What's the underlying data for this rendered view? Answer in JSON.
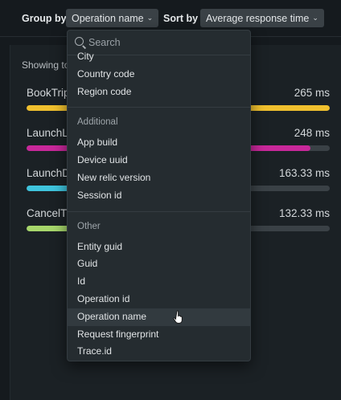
{
  "toolbar": {
    "group_by_label": "Group by",
    "group_by_value": "Operation name",
    "sort_by_label": "Sort by",
    "sort_by_value": "Average response time"
  },
  "panel": {
    "showing_text": "Showing to",
    "rows": [
      {
        "name": "BookTrip",
        "value": "265 ms",
        "fraction": 1.0,
        "color": "#f0c02e"
      },
      {
        "name": "LaunchL",
        "value": "248 ms",
        "fraction": 0.936,
        "color": "#c8289a"
      },
      {
        "name": "LaunchD",
        "value": "163.33 ms",
        "fraction": 0.616,
        "color": "#3fc4dd"
      },
      {
        "name": "CancelT",
        "value": "132.33 ms",
        "fraction": 0.499,
        "color": "#a7d66b"
      }
    ]
  },
  "dropdown": {
    "search_placeholder": "Search",
    "groups": [
      {
        "title": "",
        "items": [
          "City",
          "Country code",
          "Region code"
        ]
      },
      {
        "title": "Additional",
        "items": [
          "App build",
          "Device uuid",
          "New relic version",
          "Session id"
        ]
      },
      {
        "title": "Other",
        "items": [
          "Entity guid",
          "Guid",
          "Id",
          "Operation id",
          "Operation name",
          "Request fingerprint",
          "Trace.id"
        ]
      }
    ],
    "hovered_item": "Operation name"
  },
  "icons": {
    "chevron": "chevron-down-icon",
    "search": "search-icon",
    "cursor": "hand-pointer-icon"
  }
}
